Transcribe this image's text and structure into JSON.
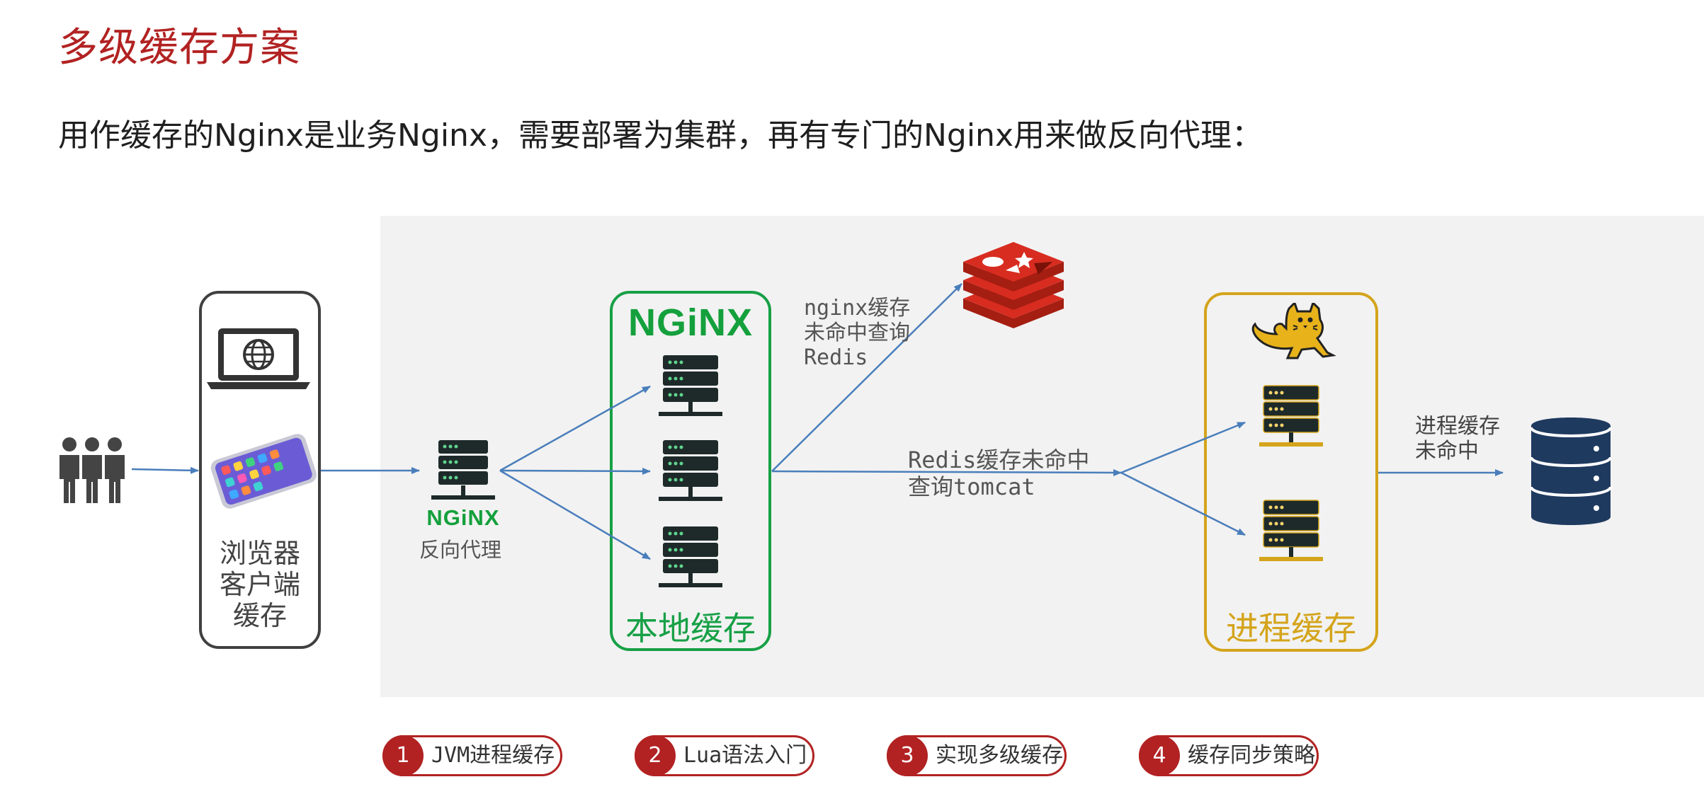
{
  "title": "多级缓存方案",
  "subtitle": "用作缓存的Nginx是业务Nginx，需要部署为集群，再有专门的Nginx用来做反向代理：",
  "diagram": {
    "browser_label": "浏览器\n客户端\n缓存",
    "proxy_logo": "NGiNX",
    "proxy_label": "反向代理",
    "nginx_logo": "NGiNX",
    "nginx_cluster_label": "本地缓存",
    "note_nginx_redis": "nginx缓存\n未命中查询\nRedis",
    "note_redis_tomcat": "Redis缓存未命中\n查询tomcat",
    "tomcat_cluster_label": "进程缓存",
    "note_tomcat_db": "进程缓存\n未命中",
    "colors": {
      "nginx": "#17a046",
      "tomcat": "#d4a41b",
      "arrow": "#4a7ebb",
      "server": "#1e2a2a",
      "redis": "#d82c20",
      "database": "#1f3a5f"
    }
  },
  "chapters": [
    {
      "num": "1",
      "label": "JVM进程缓存"
    },
    {
      "num": "2",
      "label": "Lua语法入门"
    },
    {
      "num": "3",
      "label": "实现多级缓存"
    },
    {
      "num": "4",
      "label": "缓存同步策略"
    }
  ]
}
